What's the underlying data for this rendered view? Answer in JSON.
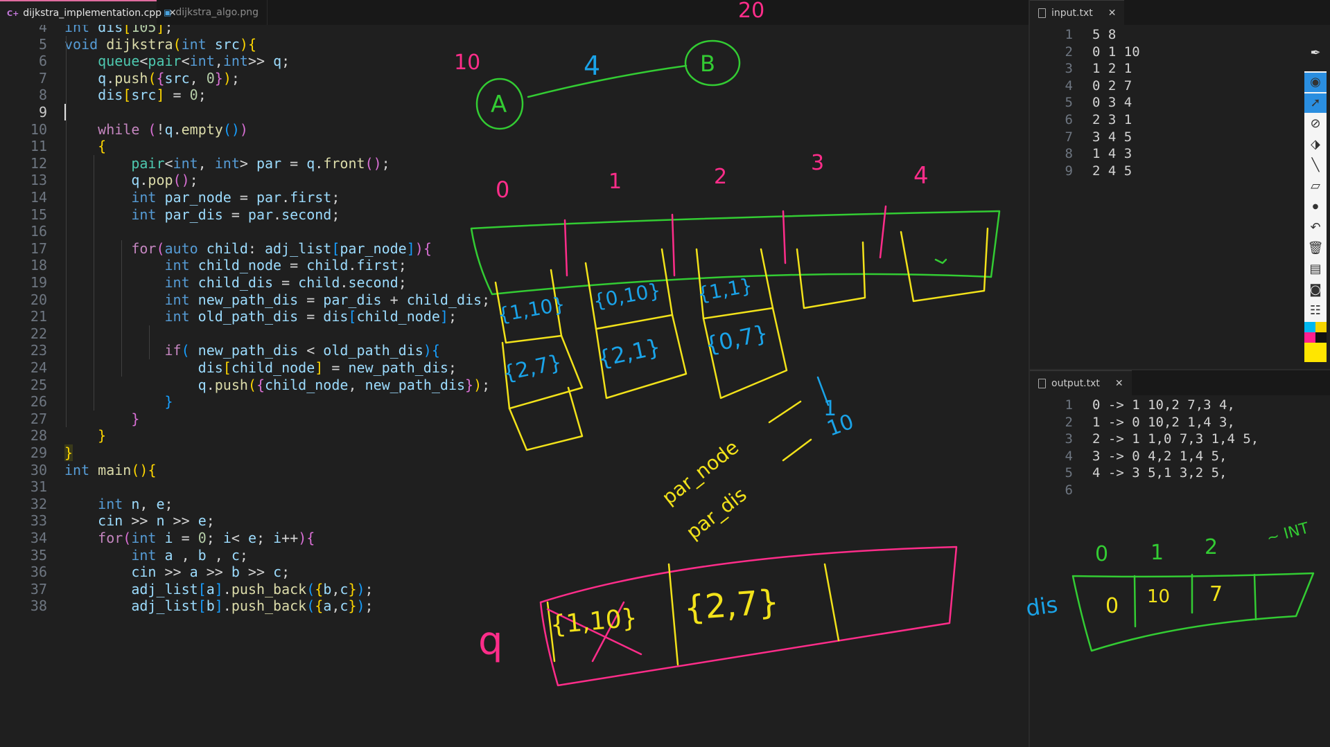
{
  "tabs": [
    {
      "label": "dijkstra_implementation.cpp",
      "active": true
    },
    {
      "label": "dijkstra_algo.png",
      "active": false
    }
  ],
  "code_lines": [
    {
      "n": "4",
      "tokens": [
        {
          "t": "int",
          "c": "kw"
        },
        {
          "t": " dis",
          "c": "var"
        },
        {
          "t": "[",
          "c": "br1"
        },
        {
          "t": "105",
          "c": "num"
        },
        {
          "t": "]",
          "c": "br1"
        },
        {
          "t": ";",
          "c": "pl"
        }
      ]
    },
    {
      "n": "5",
      "tokens": [
        {
          "t": "void",
          "c": "kw"
        },
        {
          "t": " ",
          "c": "pl"
        },
        {
          "t": "dijkstra",
          "c": "fn"
        },
        {
          "t": "(",
          "c": "br1"
        },
        {
          "t": "int",
          "c": "kw"
        },
        {
          "t": " src",
          "c": "var"
        },
        {
          "t": ")",
          "c": "br1"
        },
        {
          "t": "{",
          "c": "br1"
        }
      ]
    },
    {
      "n": "6",
      "tokens": [
        {
          "t": "    queue",
          "c": "ty"
        },
        {
          "t": "<",
          "c": "pl"
        },
        {
          "t": "pair",
          "c": "ty"
        },
        {
          "t": "<",
          "c": "pl"
        },
        {
          "t": "int",
          "c": "kw"
        },
        {
          "t": ",",
          "c": "pl"
        },
        {
          "t": "int",
          "c": "kw"
        },
        {
          "t": ">> ",
          "c": "pl"
        },
        {
          "t": "q",
          "c": "var"
        },
        {
          "t": ";",
          "c": "pl"
        }
      ]
    },
    {
      "n": "7",
      "tokens": [
        {
          "t": "    q",
          "c": "var"
        },
        {
          "t": ".",
          "c": "pl"
        },
        {
          "t": "push",
          "c": "fn"
        },
        {
          "t": "(",
          "c": "br1"
        },
        {
          "t": "{",
          "c": "br2"
        },
        {
          "t": "src",
          "c": "var"
        },
        {
          "t": ", ",
          "c": "pl"
        },
        {
          "t": "0",
          "c": "num"
        },
        {
          "t": "}",
          "c": "br2"
        },
        {
          "t": ")",
          "c": "br1"
        },
        {
          "t": ";",
          "c": "pl"
        }
      ]
    },
    {
      "n": "8",
      "tokens": [
        {
          "t": "    dis",
          "c": "var"
        },
        {
          "t": "[",
          "c": "br1"
        },
        {
          "t": "src",
          "c": "var"
        },
        {
          "t": "]",
          "c": "br1"
        },
        {
          "t": " = ",
          "c": "pl"
        },
        {
          "t": "0",
          "c": "num"
        },
        {
          "t": ";",
          "c": "pl"
        }
      ]
    },
    {
      "n": "9",
      "tokens": [],
      "current": true
    },
    {
      "n": "10",
      "tokens": [
        {
          "t": "    while",
          "c": "ctl"
        },
        {
          "t": " ",
          "c": "pl"
        },
        {
          "t": "(",
          "c": "br2"
        },
        {
          "t": "!",
          "c": "pl"
        },
        {
          "t": "q",
          "c": "var"
        },
        {
          "t": ".",
          "c": "pl"
        },
        {
          "t": "empty",
          "c": "fn"
        },
        {
          "t": "()",
          "c": "br3"
        },
        {
          "t": ")",
          "c": "br2"
        }
      ]
    },
    {
      "n": "11",
      "tokens": [
        {
          "t": "    ",
          "c": "pl"
        },
        {
          "t": "{",
          "c": "br1"
        }
      ]
    },
    {
      "n": "12",
      "tokens": [
        {
          "t": "        pair",
          "c": "ty"
        },
        {
          "t": "<",
          "c": "pl"
        },
        {
          "t": "int",
          "c": "kw"
        },
        {
          "t": ", ",
          "c": "pl"
        },
        {
          "t": "int",
          "c": "kw"
        },
        {
          "t": "> ",
          "c": "pl"
        },
        {
          "t": "par",
          "c": "var"
        },
        {
          "t": " = ",
          "c": "pl"
        },
        {
          "t": "q",
          "c": "var"
        },
        {
          "t": ".",
          "c": "pl"
        },
        {
          "t": "front",
          "c": "fn"
        },
        {
          "t": "()",
          "c": "br2"
        },
        {
          "t": ";",
          "c": "pl"
        }
      ]
    },
    {
      "n": "13",
      "tokens": [
        {
          "t": "        q",
          "c": "var"
        },
        {
          "t": ".",
          "c": "pl"
        },
        {
          "t": "pop",
          "c": "fn"
        },
        {
          "t": "()",
          "c": "br2"
        },
        {
          "t": ";",
          "c": "pl"
        }
      ]
    },
    {
      "n": "14",
      "tokens": [
        {
          "t": "        int",
          "c": "kw"
        },
        {
          "t": " par_node",
          "c": "var"
        },
        {
          "t": " = ",
          "c": "pl"
        },
        {
          "t": "par",
          "c": "var"
        },
        {
          "t": ".",
          "c": "pl"
        },
        {
          "t": "first",
          "c": "var"
        },
        {
          "t": ";",
          "c": "pl"
        }
      ]
    },
    {
      "n": "15",
      "tokens": [
        {
          "t": "        int",
          "c": "kw"
        },
        {
          "t": " par_dis",
          "c": "var"
        },
        {
          "t": " = ",
          "c": "pl"
        },
        {
          "t": "par",
          "c": "var"
        },
        {
          "t": ".",
          "c": "pl"
        },
        {
          "t": "second",
          "c": "var"
        },
        {
          "t": ";",
          "c": "pl"
        }
      ]
    },
    {
      "n": "16",
      "tokens": []
    },
    {
      "n": "17",
      "tokens": [
        {
          "t": "        for",
          "c": "ctl"
        },
        {
          "t": "(",
          "c": "br2"
        },
        {
          "t": "auto",
          "c": "kw"
        },
        {
          "t": " child",
          "c": "var"
        },
        {
          "t": ": ",
          "c": "pl"
        },
        {
          "t": "adj_list",
          "c": "var"
        },
        {
          "t": "[",
          "c": "br3"
        },
        {
          "t": "par_node",
          "c": "var"
        },
        {
          "t": "]",
          "c": "br3"
        },
        {
          "t": ")",
          "c": "br2"
        },
        {
          "t": "{",
          "c": "br2"
        }
      ]
    },
    {
      "n": "18",
      "tokens": [
        {
          "t": "            int",
          "c": "kw"
        },
        {
          "t": " child_node",
          "c": "var"
        },
        {
          "t": " = ",
          "c": "pl"
        },
        {
          "t": "child",
          "c": "var"
        },
        {
          "t": ".",
          "c": "pl"
        },
        {
          "t": "first",
          "c": "var"
        },
        {
          "t": ";",
          "c": "pl"
        }
      ]
    },
    {
      "n": "19",
      "tokens": [
        {
          "t": "            int",
          "c": "kw"
        },
        {
          "t": " child_dis",
          "c": "var"
        },
        {
          "t": " = ",
          "c": "pl"
        },
        {
          "t": "child",
          "c": "var"
        },
        {
          "t": ".",
          "c": "pl"
        },
        {
          "t": "second",
          "c": "var"
        },
        {
          "t": ";",
          "c": "pl"
        }
      ]
    },
    {
      "n": "20",
      "tokens": [
        {
          "t": "            int",
          "c": "kw"
        },
        {
          "t": " new_path_dis",
          "c": "var"
        },
        {
          "t": " = ",
          "c": "pl"
        },
        {
          "t": "par_dis",
          "c": "var"
        },
        {
          "t": " + ",
          "c": "pl"
        },
        {
          "t": "child_dis",
          "c": "var"
        },
        {
          "t": ";",
          "c": "pl"
        }
      ]
    },
    {
      "n": "21",
      "tokens": [
        {
          "t": "            int",
          "c": "kw"
        },
        {
          "t": " old_path_dis",
          "c": "var"
        },
        {
          "t": " = ",
          "c": "pl"
        },
        {
          "t": "dis",
          "c": "var"
        },
        {
          "t": "[",
          "c": "br3"
        },
        {
          "t": "child_node",
          "c": "var"
        },
        {
          "t": "]",
          "c": "br3"
        },
        {
          "t": ";",
          "c": "pl"
        }
      ]
    },
    {
      "n": "22",
      "tokens": []
    },
    {
      "n": "23",
      "tokens": [
        {
          "t": "            if",
          "c": "ctl"
        },
        {
          "t": "( ",
          "c": "br3"
        },
        {
          "t": "new_path_dis",
          "c": "var"
        },
        {
          "t": " < ",
          "c": "pl"
        },
        {
          "t": "old_path_dis",
          "c": "var"
        },
        {
          "t": ")",
          "c": "br3"
        },
        {
          "t": "{",
          "c": "br3"
        }
      ]
    },
    {
      "n": "24",
      "tokens": [
        {
          "t": "                dis",
          "c": "var"
        },
        {
          "t": "[",
          "c": "br1"
        },
        {
          "t": "child_node",
          "c": "var"
        },
        {
          "t": "]",
          "c": "br1"
        },
        {
          "t": " = ",
          "c": "pl"
        },
        {
          "t": "new_path_dis",
          "c": "var"
        },
        {
          "t": ";",
          "c": "pl"
        }
      ]
    },
    {
      "n": "25",
      "tokens": [
        {
          "t": "                q",
          "c": "var"
        },
        {
          "t": ".",
          "c": "pl"
        },
        {
          "t": "push",
          "c": "fn"
        },
        {
          "t": "(",
          "c": "br1"
        },
        {
          "t": "{",
          "c": "br2"
        },
        {
          "t": "child_node",
          "c": "var"
        },
        {
          "t": ", ",
          "c": "pl"
        },
        {
          "t": "new_path_dis",
          "c": "var"
        },
        {
          "t": "}",
          "c": "br2"
        },
        {
          "t": ")",
          "c": "br1"
        },
        {
          "t": ";",
          "c": "pl"
        }
      ]
    },
    {
      "n": "26",
      "tokens": [
        {
          "t": "            ",
          "c": "pl"
        },
        {
          "t": "}",
          "c": "br3"
        }
      ]
    },
    {
      "n": "27",
      "tokens": [
        {
          "t": "        ",
          "c": "pl"
        },
        {
          "t": "}",
          "c": "br2"
        }
      ]
    },
    {
      "n": "28",
      "tokens": [
        {
          "t": "    ",
          "c": "pl"
        },
        {
          "t": "}",
          "c": "br1"
        }
      ]
    },
    {
      "n": "29",
      "tokens": [
        {
          "t": "}",
          "c": "br1h"
        }
      ]
    },
    {
      "n": "30",
      "tokens": [
        {
          "t": "int",
          "c": "kw"
        },
        {
          "t": " ",
          "c": "pl"
        },
        {
          "t": "main",
          "c": "fn"
        },
        {
          "t": "()",
          "c": "br1"
        },
        {
          "t": "{",
          "c": "br1"
        }
      ]
    },
    {
      "n": "31",
      "tokens": []
    },
    {
      "n": "32",
      "tokens": [
        {
          "t": "    int",
          "c": "kw"
        },
        {
          "t": " n",
          "c": "var"
        },
        {
          "t": ", ",
          "c": "pl"
        },
        {
          "t": "e",
          "c": "var"
        },
        {
          "t": ";",
          "c": "pl"
        }
      ]
    },
    {
      "n": "33",
      "tokens": [
        {
          "t": "    cin",
          "c": "var"
        },
        {
          "t": " >> ",
          "c": "pl"
        },
        {
          "t": "n",
          "c": "var"
        },
        {
          "t": " >> ",
          "c": "pl"
        },
        {
          "t": "e",
          "c": "var"
        },
        {
          "t": ";",
          "c": "pl"
        }
      ]
    },
    {
      "n": "34",
      "tokens": [
        {
          "t": "    for",
          "c": "ctl"
        },
        {
          "t": "(",
          "c": "br2"
        },
        {
          "t": "int",
          "c": "kw"
        },
        {
          "t": " i",
          "c": "var"
        },
        {
          "t": " = ",
          "c": "pl"
        },
        {
          "t": "0",
          "c": "num"
        },
        {
          "t": "; ",
          "c": "pl"
        },
        {
          "t": "i",
          "c": "var"
        },
        {
          "t": "< ",
          "c": "pl"
        },
        {
          "t": "e",
          "c": "var"
        },
        {
          "t": "; ",
          "c": "pl"
        },
        {
          "t": "i",
          "c": "var"
        },
        {
          "t": "++",
          "c": "pl"
        },
        {
          "t": ")",
          "c": "br2"
        },
        {
          "t": "{",
          "c": "br2"
        }
      ]
    },
    {
      "n": "35",
      "tokens": [
        {
          "t": "        int",
          "c": "kw"
        },
        {
          "t": " a",
          "c": "var"
        },
        {
          "t": " , ",
          "c": "pl"
        },
        {
          "t": "b",
          "c": "var"
        },
        {
          "t": " , ",
          "c": "pl"
        },
        {
          "t": "c",
          "c": "var"
        },
        {
          "t": ";",
          "c": "pl"
        }
      ]
    },
    {
      "n": "36",
      "tokens": [
        {
          "t": "        cin",
          "c": "var"
        },
        {
          "t": " >> ",
          "c": "pl"
        },
        {
          "t": "a",
          "c": "var"
        },
        {
          "t": " >> ",
          "c": "pl"
        },
        {
          "t": "b",
          "c": "var"
        },
        {
          "t": " >> ",
          "c": "pl"
        },
        {
          "t": "c",
          "c": "var"
        },
        {
          "t": ";",
          "c": "pl"
        }
      ]
    },
    {
      "n": "37",
      "tokens": [
        {
          "t": "        adj_list",
          "c": "var"
        },
        {
          "t": "[",
          "c": "br3"
        },
        {
          "t": "a",
          "c": "var"
        },
        {
          "t": "]",
          "c": "br3"
        },
        {
          "t": ".",
          "c": "pl"
        },
        {
          "t": "push_back",
          "c": "fn"
        },
        {
          "t": "(",
          "c": "br3"
        },
        {
          "t": "{",
          "c": "br1"
        },
        {
          "t": "b",
          "c": "var"
        },
        {
          "t": ",",
          "c": "pl"
        },
        {
          "t": "c",
          "c": "var"
        },
        {
          "t": "}",
          "c": "br1"
        },
        {
          "t": ")",
          "c": "br3"
        },
        {
          "t": ";",
          "c": "pl"
        }
      ]
    },
    {
      "n": "38",
      "tokens": [
        {
          "t": "        adj_list",
          "c": "var"
        },
        {
          "t": "[",
          "c": "br3"
        },
        {
          "t": "b",
          "c": "var"
        },
        {
          "t": "]",
          "c": "br3"
        },
        {
          "t": ".",
          "c": "pl"
        },
        {
          "t": "push_back",
          "c": "fn"
        },
        {
          "t": "(",
          "c": "br3"
        },
        {
          "t": "{",
          "c": "br1"
        },
        {
          "t": "a",
          "c": "var"
        },
        {
          "t": ",",
          "c": "pl"
        },
        {
          "t": "c",
          "c": "var"
        },
        {
          "t": "}",
          "c": "br1"
        },
        {
          "t": ")",
          "c": "br3"
        },
        {
          "t": ";",
          "c": "pl"
        }
      ]
    }
  ],
  "input_pane": {
    "tab_label": "input.txt",
    "lines": [
      {
        "n": "1",
        "text": "5 8"
      },
      {
        "n": "2",
        "text": "0 1 10"
      },
      {
        "n": "3",
        "text": "1 2 1"
      },
      {
        "n": "4",
        "text": "0 2 7"
      },
      {
        "n": "5",
        "text": "0 3 4"
      },
      {
        "n": "6",
        "text": "2 3 1"
      },
      {
        "n": "7",
        "text": "3 4 5"
      },
      {
        "n": "8",
        "text": "1 4 3"
      },
      {
        "n": "9",
        "text": "2 4 5"
      }
    ]
  },
  "output_pane": {
    "tab_label": "output.txt",
    "lines": [
      {
        "n": "1",
        "text": "0 -> 1 10,2 7,3 4,"
      },
      {
        "n": "2",
        "text": "1 -> 0 10,2 1,4 3,"
      },
      {
        "n": "3",
        "text": "2 -> 1 1,0 7,3 1,4 5,"
      },
      {
        "n": "4",
        "text": "3 -> 0 4,2 1,4 5,"
      },
      {
        "n": "5",
        "text": "4 -> 3 5,1 3,2 5,"
      },
      {
        "n": "6",
        "text": ""
      }
    ]
  },
  "annotations": {
    "top_20": "20",
    "node_a": "A",
    "node_b": "B",
    "edge_weight": "4",
    "node_a_dist": "10",
    "index_labels": [
      "0",
      "1",
      "2",
      "3",
      "4"
    ],
    "cells_top": [
      "{1,10}",
      "{0,10}",
      "{1,1}"
    ],
    "cells_mid": [
      "{2,7}",
      "{2,1}",
      "{0,7}"
    ],
    "par_node": "par_node",
    "par_dis": "par_dis",
    "par_value_1": "1",
    "par_value_10": "10",
    "queue_label": "q",
    "queue_cells": [
      "{1,10}",
      "{2,7}"
    ],
    "dis_label": "dis",
    "dis_indices": [
      "0",
      "1",
      "2"
    ],
    "dis_values": [
      "0",
      "10",
      "7"
    ],
    "dis_trailing": "~ INT"
  },
  "colors": {
    "keyword": "#569cd6",
    "control": "#c586c0",
    "function": "#dcdcaa",
    "type": "#4ec9b0",
    "variable": "#9cdcfe",
    "number": "#b5cea8",
    "bracket1": "#ffd700",
    "bracket2": "#da70d6",
    "bracket3": "#179fff",
    "ink_green": "#33cc33",
    "ink_pink": "#ff2d8a",
    "ink_yellow": "#f2e21a",
    "ink_blue": "#1aa3e8"
  },
  "toolbar_icons": [
    "pen-icon",
    "eye-icon",
    "cursor-icon",
    "eraser-icon",
    "tag-icon",
    "line-icon",
    "ruler-icon",
    "dot-icon",
    "undo-icon",
    "trash-icon",
    "board-icon",
    "camera-icon",
    "clipboard-icon"
  ]
}
